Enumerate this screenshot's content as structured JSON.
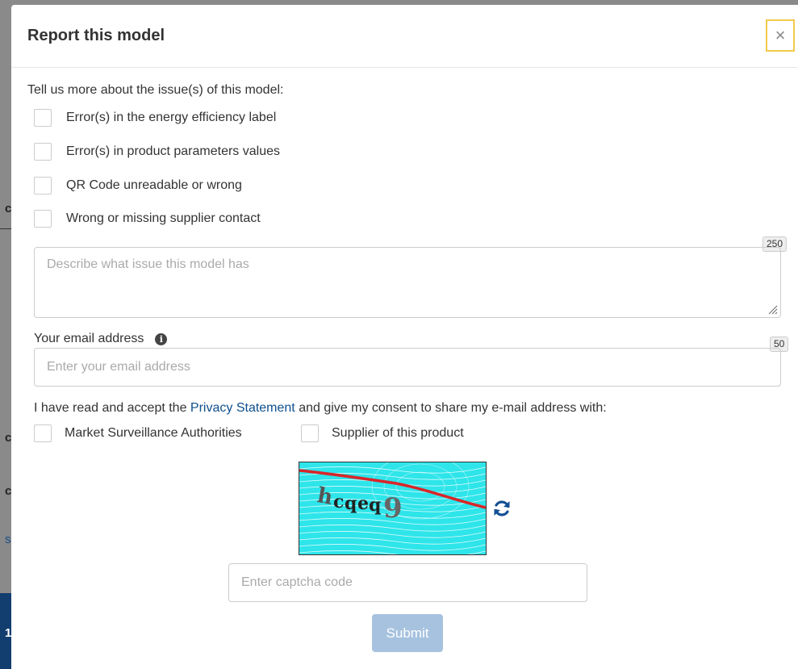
{
  "modal": {
    "title": "Report this model",
    "close_symbol": "×"
  },
  "form": {
    "intro": "Tell us more about the issue(s) of this model:",
    "issues": [
      {
        "label": "Error(s) in the energy efficiency label",
        "checked": false
      },
      {
        "label": "Error(s) in product parameters values",
        "checked": false
      },
      {
        "label": "QR Code unreadable or wrong",
        "checked": false
      },
      {
        "label": "Wrong or missing supplier contact",
        "checked": false
      }
    ],
    "description": {
      "placeholder": "Describe what issue this model has",
      "counter": "250"
    },
    "email": {
      "label": "Your email address",
      "info_icon": "info-circle-icon",
      "placeholder": "Enter your email address",
      "counter": "50"
    },
    "consent": {
      "before_link": "I have read and accept the ",
      "link_text": "Privacy Statement",
      "after_link": " and give my consent to share my e-mail address with:",
      "options": [
        {
          "label": "Market Surveillance Authorities",
          "checked": false
        },
        {
          "label": "Supplier of this product",
          "checked": false
        }
      ]
    },
    "captcha": {
      "code_text": "hcqeq9",
      "refresh_icon": "refresh-icon",
      "placeholder": "Enter captcha code",
      "background_color": "#2ee5ea"
    },
    "submit_label": "Submit"
  },
  "background": {
    "letters": [
      "c",
      "c",
      "c",
      "s",
      "1"
    ]
  },
  "colors": {
    "link": "#0e4f8f",
    "submit_disabled": "#a6c2df",
    "close_focus_border": "#f2c94c"
  }
}
